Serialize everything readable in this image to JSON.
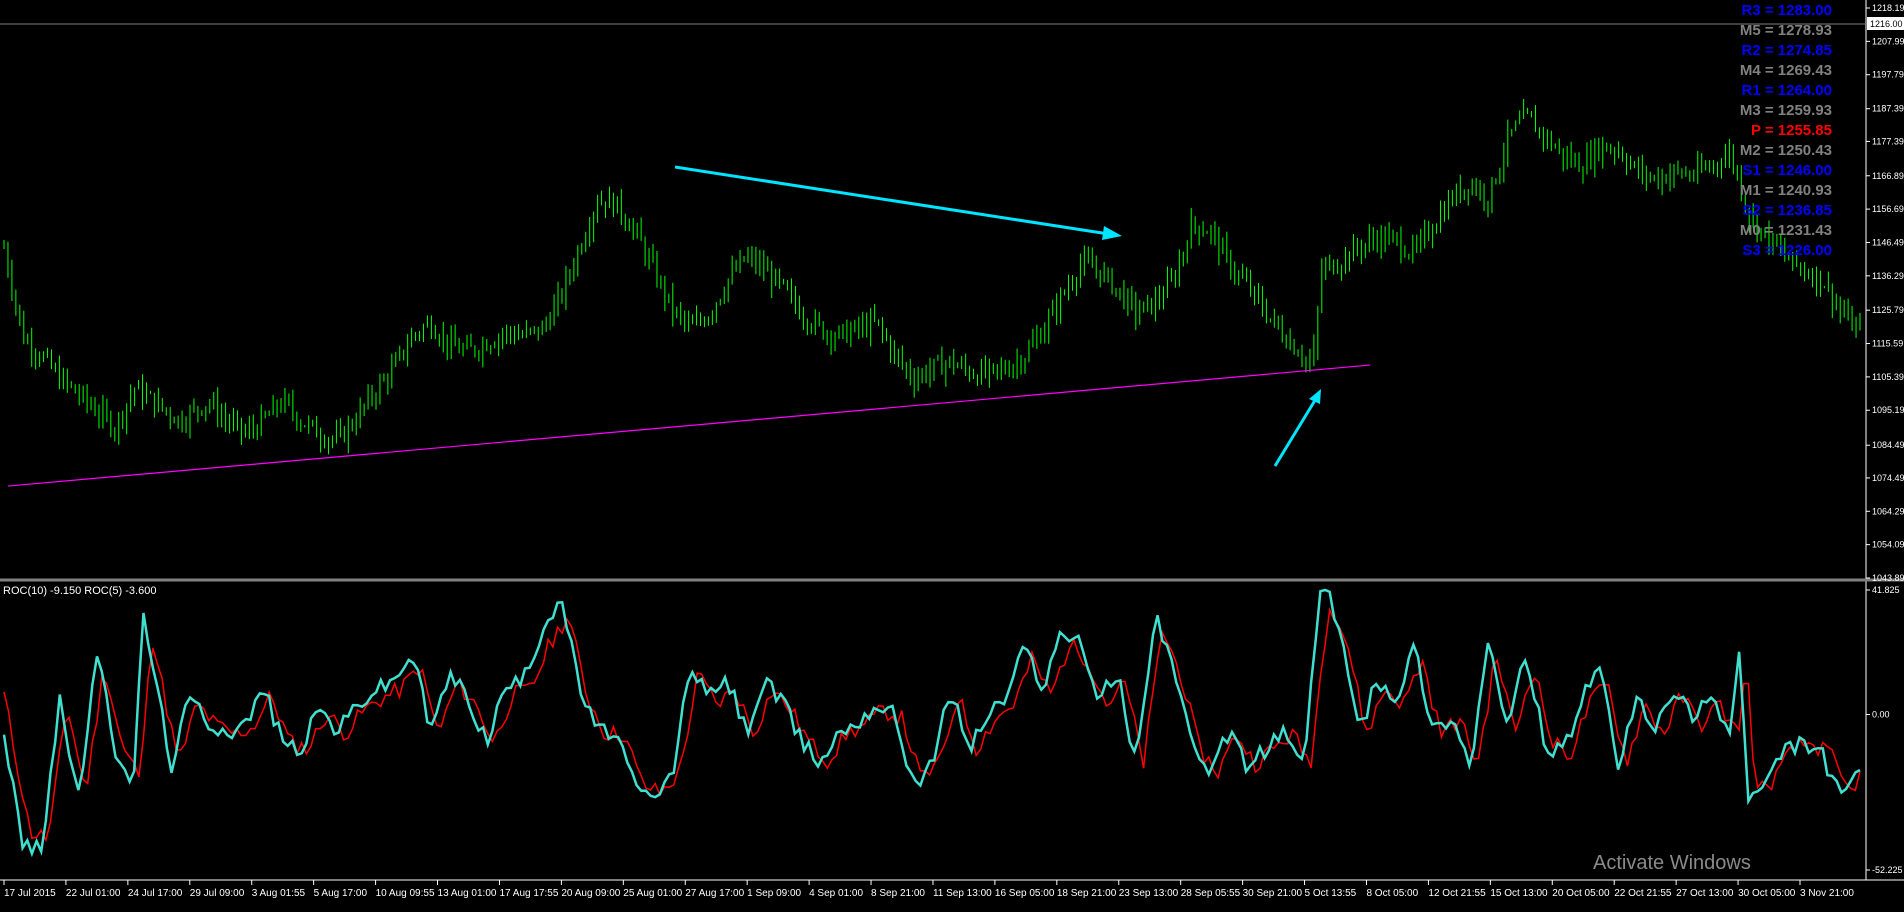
{
  "chart_data": [
    {
      "type": "candlestick",
      "title": "",
      "price_scale": [
        "1218.19",
        "1207.99",
        "1197.79",
        "1187.39",
        "1177.39",
        "1166.89",
        "1156.69",
        "1146.49",
        "1136.29",
        "1125.79",
        "1115.59",
        "1105.39",
        "1095.19",
        "1084.49",
        "1074.49",
        "1064.29",
        "1054.09",
        "1043.89"
      ],
      "ylim": [
        1043.89,
        1218.19
      ],
      "current_price": "1216.00",
      "grid": false,
      "close_path": [
        [
          0,
          1145
        ],
        [
          0.01,
          1118
        ],
        [
          0.02,
          1112
        ],
        [
          0.03,
          1105
        ],
        [
          0.05,
          1095
        ],
        [
          0.06,
          1090
        ],
        [
          0.07,
          1102
        ],
        [
          0.08,
          1098
        ],
        [
          0.095,
          1092
        ],
        [
          0.11,
          1098
        ],
        [
          0.12,
          1092
        ],
        [
          0.13,
          1088
        ],
        [
          0.14,
          1092
        ],
        [
          0.15,
          1098
        ],
        [
          0.16,
          1092
        ],
        [
          0.17,
          1088
        ],
        [
          0.18,
          1086
        ],
        [
          0.19,
          1093
        ],
        [
          0.2,
          1101
        ],
        [
          0.21,
          1108
        ],
        [
          0.22,
          1118
        ],
        [
          0.23,
          1122
        ],
        [
          0.24,
          1115
        ],
        [
          0.25,
          1113
        ],
        [
          0.26,
          1116
        ],
        [
          0.27,
          1119
        ],
        [
          0.28,
          1118
        ],
        [
          0.29,
          1120
        ],
        [
          0.3,
          1130
        ],
        [
          0.31,
          1145
        ],
        [
          0.32,
          1160
        ],
        [
          0.33,
          1158
        ],
        [
          0.34,
          1150
        ],
        [
          0.35,
          1138
        ],
        [
          0.36,
          1126
        ],
        [
          0.37,
          1120
        ],
        [
          0.38,
          1125
        ],
        [
          0.39,
          1135
        ],
        [
          0.4,
          1142
        ],
        [
          0.41,
          1138
        ],
        [
          0.42,
          1132
        ],
        [
          0.43,
          1125
        ],
        [
          0.44,
          1120
        ],
        [
          0.45,
          1118
        ],
        [
          0.46,
          1120
        ],
        [
          0.47,
          1122
        ],
        [
          0.48,
          1112
        ],
        [
          0.49,
          1105
        ],
        [
          0.5,
          1108
        ],
        [
          0.51,
          1110
        ],
        [
          0.52,
          1107
        ],
        [
          0.53,
          1106
        ],
        [
          0.54,
          1108
        ],
        [
          0.55,
          1112
        ],
        [
          0.56,
          1120
        ],
        [
          0.57,
          1130
        ],
        [
          0.58,
          1140
        ],
        [
          0.59,
          1138
        ],
        [
          0.6,
          1132
        ],
        [
          0.61,
          1125
        ],
        [
          0.62,
          1128
        ],
        [
          0.63,
          1135
        ],
        [
          0.64,
          1152
        ],
        [
          0.65,
          1150
        ],
        [
          0.66,
          1140
        ],
        [
          0.67,
          1133
        ],
        [
          0.68,
          1125
        ],
        [
          0.69,
          1118
        ],
        [
          0.7,
          1112
        ],
        [
          0.705,
          1108
        ],
        [
          0.71,
          1138
        ],
        [
          0.72,
          1141
        ],
        [
          0.73,
          1145
        ],
        [
          0.74,
          1148
        ],
        [
          0.75,
          1147
        ],
        [
          0.76,
          1143
        ],
        [
          0.77,
          1152
        ],
        [
          0.78,
          1160
        ],
        [
          0.79,
          1165
        ],
        [
          0.8,
          1160
        ],
        [
          0.81,
          1178
        ],
        [
          0.82,
          1185
        ],
        [
          0.83,
          1179
        ],
        [
          0.84,
          1173
        ],
        [
          0.85,
          1170
        ],
        [
          0.86,
          1176
        ],
        [
          0.87,
          1175
        ],
        [
          0.88,
          1168
        ],
        [
          0.89,
          1166
        ],
        [
          0.9,
          1168
        ],
        [
          0.91,
          1167
        ],
        [
          0.92,
          1170
        ],
        [
          0.93,
          1174
        ],
        [
          0.935,
          1165
        ],
        [
          0.94,
          1155
        ],
        [
          0.95,
          1148
        ],
        [
          0.96,
          1142
        ],
        [
          0.97,
          1138
        ],
        [
          0.98,
          1135
        ],
        [
          0.99,
          1125
        ],
        [
          1.0,
          1119
        ]
      ]
    },
    {
      "type": "line",
      "title": "",
      "legend": "ROC(10) -9.150  ROC(5) -3.600",
      "ylim": [
        -52.225,
        41.825
      ],
      "y_labels": [
        "41.825",
        "0.00",
        "-52.225"
      ],
      "series": [
        {
          "name": "ROC(10)",
          "color": "#ff0000",
          "offset": -1.5,
          "amp": 1.0
        },
        {
          "name": "ROC(5)",
          "color": "#40e0d0",
          "offset": 0,
          "amp": 1.15
        }
      ],
      "roc_path": [
        [
          0,
          -5
        ],
        [
          0.01,
          -38
        ],
        [
          0.02,
          -40
        ],
        [
          0.03,
          5
        ],
        [
          0.04,
          -25
        ],
        [
          0.05,
          18
        ],
        [
          0.06,
          -10
        ],
        [
          0.07,
          -20
        ],
        [
          0.075,
          30
        ],
        [
          0.09,
          -15
        ],
        [
          0.1,
          5
        ],
        [
          0.11,
          -2
        ],
        [
          0.12,
          -5
        ],
        [
          0.13,
          -3
        ],
        [
          0.14,
          8
        ],
        [
          0.15,
          -8
        ],
        [
          0.16,
          -10
        ],
        [
          0.17,
          2
        ],
        [
          0.18,
          -5
        ],
        [
          0.19,
          3
        ],
        [
          0.2,
          7
        ],
        [
          0.21,
          10
        ],
        [
          0.22,
          18
        ],
        [
          0.23,
          -5
        ],
        [
          0.24,
          12
        ],
        [
          0.25,
          5
        ],
        [
          0.26,
          -8
        ],
        [
          0.27,
          8
        ],
        [
          0.28,
          10
        ],
        [
          0.29,
          25
        ],
        [
          0.3,
          35
        ],
        [
          0.31,
          8
        ],
        [
          0.32,
          -5
        ],
        [
          0.33,
          -5
        ],
        [
          0.34,
          -22
        ],
        [
          0.35,
          -25
        ],
        [
          0.36,
          -18
        ],
        [
          0.37,
          15
        ],
        [
          0.38,
          5
        ],
        [
          0.39,
          10
        ],
        [
          0.4,
          -5
        ],
        [
          0.41,
          10
        ],
        [
          0.42,
          3
        ],
        [
          0.43,
          -8
        ],
        [
          0.44,
          -14
        ],
        [
          0.45,
          -5
        ],
        [
          0.46,
          -2
        ],
        [
          0.47,
          3
        ],
        [
          0.48,
          0
        ],
        [
          0.49,
          -20
        ],
        [
          0.5,
          -15
        ],
        [
          0.51,
          8
        ],
        [
          0.52,
          -10
        ],
        [
          0.53,
          0
        ],
        [
          0.54,
          5
        ],
        [
          0.55,
          20
        ],
        [
          0.56,
          8
        ],
        [
          0.57,
          25
        ],
        [
          0.58,
          20
        ],
        [
          0.59,
          5
        ],
        [
          0.6,
          12
        ],
        [
          0.61,
          -15
        ],
        [
          0.62,
          30
        ],
        [
          0.63,
          15
        ],
        [
          0.64,
          -10
        ],
        [
          0.65,
          -18
        ],
        [
          0.66,
          -5
        ],
        [
          0.67,
          -15
        ],
        [
          0.68,
          -10
        ],
        [
          0.69,
          -5
        ],
        [
          0.7,
          -15
        ],
        [
          0.71,
          40
        ],
        [
          0.72,
          25
        ],
        [
          0.73,
          -5
        ],
        [
          0.74,
          10
        ],
        [
          0.75,
          5
        ],
        [
          0.76,
          20
        ],
        [
          0.77,
          -5
        ],
        [
          0.78,
          0
        ],
        [
          0.79,
          -15
        ],
        [
          0.8,
          22
        ],
        [
          0.81,
          -5
        ],
        [
          0.82,
          18
        ],
        [
          0.83,
          -8
        ],
        [
          0.84,
          -12
        ],
        [
          0.85,
          5
        ],
        [
          0.86,
          12
        ],
        [
          0.87,
          -15
        ],
        [
          0.88,
          5
        ],
        [
          0.89,
          -5
        ],
        [
          0.9,
          8
        ],
        [
          0.91,
          -2
        ],
        [
          0.92,
          5
        ],
        [
          0.93,
          -5
        ],
        [
          0.935,
          18
        ],
        [
          0.94,
          -25
        ],
        [
          0.95,
          -20
        ],
        [
          0.96,
          -10
        ],
        [
          0.97,
          -8
        ],
        [
          0.98,
          -12
        ],
        [
          0.99,
          -25
        ],
        [
          1.0,
          -15
        ]
      ]
    }
  ],
  "time_axis": [
    "17 Jul 2015",
    "22 Jul 01:00",
    "24 Jul 17:00",
    "29 Jul 09:00",
    "3 Aug 01:55",
    "5 Aug 17:00",
    "10 Aug 09:55",
    "13 Aug 01:00",
    "17 Aug 17:55",
    "20 Aug 09:00",
    "25 Aug 01:00",
    "27 Aug 17:00",
    "1 Sep 09:00",
    "4 Sep 01:00",
    "8 Sep 21:00",
    "11 Sep 13:00",
    "16 Sep 05:00",
    "18 Sep 21:00",
    "23 Sep 13:00",
    "28 Sep 05:55",
    "30 Sep 21:00",
    "5 Oct 13:55",
    "8 Oct 05:00",
    "12 Oct 21:55",
    "15 Oct 13:00",
    "20 Oct 05:00",
    "22 Oct 21:55",
    "27 Oct 13:00",
    "30 Oct 05:00",
    "3 Nov 21:00"
  ],
  "pivots": [
    {
      "label": "R3 = 1283.00",
      "color": "#0000ff"
    },
    {
      "label": "M5 = 1278.93",
      "color": "#808080"
    },
    {
      "label": "R2 = 1274.85",
      "color": "#0000ff"
    },
    {
      "label": "M4 = 1269.43",
      "color": "#808080"
    },
    {
      "label": "R1 = 1264.00",
      "color": "#0000ff"
    },
    {
      "label": "M3 = 1259.93",
      "color": "#808080"
    },
    {
      "label": "P = 1255.85",
      "color": "#ff0000"
    },
    {
      "label": "M2 = 1250.43",
      "color": "#808080"
    },
    {
      "label": "S1 = 1246.00",
      "color": "#0000ff"
    },
    {
      "label": "M1 = 1240.93",
      "color": "#808080"
    },
    {
      "label": "S2 = 1236.85",
      "color": "#0000ff"
    },
    {
      "label": "M0 = 1231.43",
      "color": "#808080"
    },
    {
      "label": "S3 = 1226.00",
      "color": "#0000ff"
    }
  ],
  "watermark": "Activate Windows",
  "colors": {
    "candle": "#00ff00",
    "trendline": "#ff00ff",
    "arrow": "#00e5ff",
    "roc10": "#ff0000",
    "roc5": "#40e0d0",
    "axis": "#ffffff"
  }
}
